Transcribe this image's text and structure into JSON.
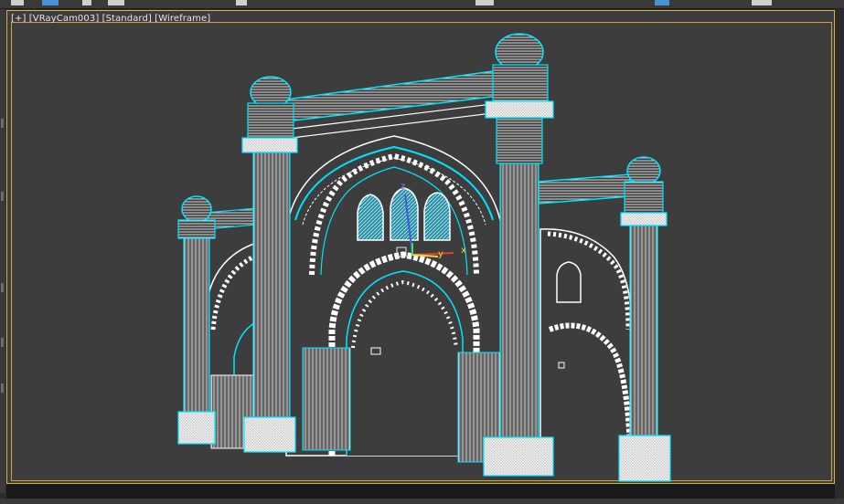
{
  "viewport": {
    "label_parts": [
      "[+]",
      "[VRayCam003]",
      "[Standard]",
      "[Wireframe]"
    ],
    "border_color": "#d8b341",
    "background": "#3d3d3d"
  },
  "scene": {
    "wire_color": "#ffffff",
    "outline_color": "#00e5ff",
    "fill_color": "#5fd3e8",
    "gizmo": {
      "x_label": "x",
      "y_label": "y",
      "z_label": "z"
    }
  },
  "toolbar": {
    "icons": [
      "toolbar-icon",
      "select-icon",
      "move-icon",
      "rotate-icon",
      "scale-icon",
      "snap-icon",
      "render-icon",
      "settings-icon"
    ]
  }
}
